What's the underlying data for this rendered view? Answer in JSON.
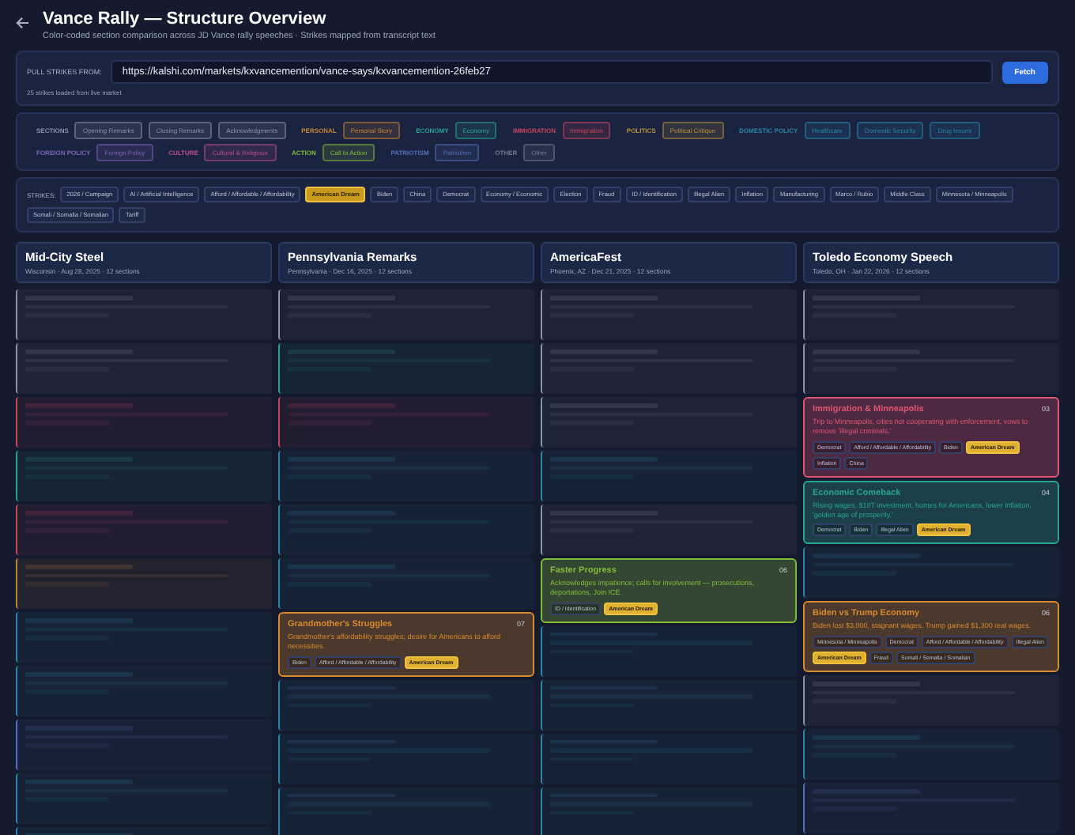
{
  "header": {
    "title": "Vance Rally — Structure Overview",
    "subtitle": "Color-coded section comparison across JD Vance rally speeches · Strikes mapped from transcript text"
  },
  "pull": {
    "label": "PULL STRIKES FROM:",
    "url": "https://kalshi.com/markets/kxvancemention/vance-says/kxvancemention-26feb27",
    "button": "Fetch",
    "status": "25 strikes loaded from live market"
  },
  "legend": [
    {
      "group": "SECTIONS",
      "color": "#8a93a8",
      "items": [
        "Opening Remarks",
        "Closing Remarks",
        "Acknowledgments"
      ]
    },
    {
      "group": "PERSONAL",
      "color": "#c8843a",
      "items": [
        "Personal Story"
      ]
    },
    {
      "group": "ECONOMY",
      "color": "#2aa392",
      "items": [
        "Economy"
      ]
    },
    {
      "group": "IMMIGRATION",
      "color": "#c8445e",
      "items": [
        "Immigration"
      ]
    },
    {
      "group": "POLITICS",
      "color": "#b8923a",
      "items": [
        "Political Critique"
      ]
    },
    {
      "group": "DOMESTIC POLICY",
      "color": "#2a86a6",
      "items": [
        "Healthcare",
        "Domestic Security",
        "Drug Issues"
      ]
    },
    {
      "group": "FOREIGN POLICY",
      "color": "#8062b8",
      "items": [
        "Foreign Policy"
      ]
    },
    {
      "group": "CULTURE",
      "color": "#b84e92",
      "items": [
        "Cultural & Religious"
      ]
    },
    {
      "group": "ACTION",
      "color": "#80bc3c",
      "items": [
        "Call to Action"
      ]
    },
    {
      "group": "PATRIOTISM",
      "color": "#5070b8",
      "items": [
        "Patriotism"
      ]
    },
    {
      "group": "OTHER",
      "color": "#767c8c",
      "items": [
        "Other"
      ]
    }
  ],
  "strikes": {
    "label": "STRIKES:",
    "items": [
      {
        "label": "2026 / Campaign",
        "selected": false
      },
      {
        "label": "AI / Artificial Intelligence",
        "selected": false
      },
      {
        "label": "Afford / Affordable / Affordability",
        "selected": false
      },
      {
        "label": "American Dream",
        "selected": true
      },
      {
        "label": "Biden",
        "selected": false
      },
      {
        "label": "China",
        "selected": false
      },
      {
        "label": "Democrat",
        "selected": false
      },
      {
        "label": "Economy / Economic",
        "selected": false
      },
      {
        "label": "Election",
        "selected": false
      },
      {
        "label": "Fraud",
        "selected": false
      },
      {
        "label": "ID / Identification",
        "selected": false
      },
      {
        "label": "Illegal Alien",
        "selected": false
      },
      {
        "label": "Inflation",
        "selected": false
      },
      {
        "label": "Manufacturing",
        "selected": false
      },
      {
        "label": "Marco / Rubio",
        "selected": false
      },
      {
        "label": "Middle Class",
        "selected": false
      },
      {
        "label": "Minnesota / Minneapolis",
        "selected": false
      },
      {
        "label": "Somali / Somalia / Somalian",
        "selected": false
      },
      {
        "label": "Tariff",
        "selected": false
      }
    ]
  },
  "speeches": [
    {
      "name": "Mid-City Steel",
      "meta": "Wisconsin · Aug 28, 2025 · 12 sections",
      "sections": [
        {
          "highlighted": false,
          "color": "#8a93a8"
        },
        {
          "highlighted": false,
          "color": "#8a93a8"
        },
        {
          "highlighted": false,
          "color": "#c8445e"
        },
        {
          "highlighted": false,
          "color": "#2aa392"
        },
        {
          "highlighted": false,
          "color": "#c8445e"
        },
        {
          "highlighted": false,
          "color": "#c8843a"
        },
        {
          "highlighted": false,
          "color": "#2a86a6"
        },
        {
          "highlighted": false,
          "color": "#2a86a6"
        },
        {
          "highlighted": false,
          "color": "#5070b8"
        },
        {
          "highlighted": false,
          "color": "#2a86a6"
        },
        {
          "highlighted": false,
          "color": "#2a86a6"
        }
      ]
    },
    {
      "name": "Pennsylvania Remarks",
      "meta": "Pennsylvania · Dec 16, 2025 · 12 sections",
      "sections": [
        {
          "highlighted": false,
          "color": "#8a93a8"
        },
        {
          "highlighted": false,
          "color": "#2aa392"
        },
        {
          "highlighted": false,
          "color": "#c8445e"
        },
        {
          "highlighted": false,
          "color": "#2a86a6"
        },
        {
          "highlighted": false,
          "color": "#2a86a6"
        },
        {
          "highlighted": false,
          "color": "#2a86a6"
        },
        {
          "highlighted": true,
          "color": "#d88a2c",
          "title": "Grandmother's Struggles",
          "number": "07",
          "description": "Grandmother's affordability struggles; desire for Americans to afford necessities.",
          "tags": [
            {
              "label": "Biden",
              "selected": false
            },
            {
              "label": "Afford / Affordable / Affordability",
              "selected": false
            },
            {
              "label": "American Dream",
              "selected": true
            }
          ]
        },
        {
          "highlighted": false,
          "color": "#2a86a6"
        },
        {
          "highlighted": false,
          "color": "#2a86a6"
        },
        {
          "highlighted": false,
          "color": "#2a86a6"
        }
      ]
    },
    {
      "name": "AmericaFest",
      "meta": "Phoenix, AZ · Dec 21, 2025 · 12 sections",
      "sections": [
        {
          "highlighted": false,
          "color": "#8a93a8"
        },
        {
          "highlighted": false,
          "color": "#8a93a8"
        },
        {
          "highlighted": false,
          "color": "#8a93a8"
        },
        {
          "highlighted": false,
          "color": "#2a86a6"
        },
        {
          "highlighted": false,
          "color": "#8a93a8"
        },
        {
          "highlighted": true,
          "color": "#80bc3c",
          "title": "Faster Progress",
          "number": "06",
          "description": "Acknowledges impatience; calls for involvement — prosecutions, deportations, Join ICE.",
          "tags": [
            {
              "label": "ID / Identification",
              "selected": false
            },
            {
              "label": "American Dream",
              "selected": true
            }
          ]
        },
        {
          "highlighted": false,
          "color": "#2a86a6"
        },
        {
          "highlighted": false,
          "color": "#2a86a6"
        },
        {
          "highlighted": false,
          "color": "#2a86a6"
        },
        {
          "highlighted": false,
          "color": "#2a86a6"
        }
      ]
    },
    {
      "name": "Toledo Economy Speech",
      "meta": "Toledo, OH · Jan 22, 2026 · 12 sections",
      "sections": [
        {
          "highlighted": false,
          "color": "#8a93a8"
        },
        {
          "highlighted": false,
          "color": "#8a93a8"
        },
        {
          "highlighted": true,
          "color": "#e05474",
          "title": "Immigration & Minneapolis",
          "number": "03",
          "description": "Trip to Minneapolis, cities not cooperating with enforcement, vows to remove 'illegal criminals.'",
          "tags": [
            {
              "label": "Democrat",
              "selected": false
            },
            {
              "label": "Afford / Affordable / Affordability",
              "selected": false
            },
            {
              "label": "Biden",
              "selected": false
            },
            {
              "label": "American Dream",
              "selected": true
            },
            {
              "label": "Inflation",
              "selected": false
            },
            {
              "label": "China",
              "selected": false
            }
          ]
        },
        {
          "highlighted": true,
          "color": "#2aa392",
          "title": "Economic Comeback",
          "number": "04",
          "description": "Rising wages, $18T investment, homes for Americans, lower inflation, 'golden age of prosperity.'",
          "tags": [
            {
              "label": "Democrat",
              "selected": false
            },
            {
              "label": "Biden",
              "selected": false
            },
            {
              "label": "Illegal Alien",
              "selected": false
            },
            {
              "label": "American Dream",
              "selected": true
            }
          ]
        },
        {
          "highlighted": false,
          "color": "#2a86a6"
        },
        {
          "highlighted": true,
          "color": "#d88a2c",
          "title": "Biden vs Trump Economy",
          "number": "06",
          "description": "Biden lost $3,000, stagnant wages. Trump gained $1,300 real wages.",
          "tags": [
            {
              "label": "Minnesota / Minneapolis",
              "selected": false
            },
            {
              "label": "Democrat",
              "selected": false
            },
            {
              "label": "Afford / Affordable / Affordability",
              "selected": false
            },
            {
              "label": "Illegal Alien",
              "selected": false
            },
            {
              "label": "American Dream",
              "selected": true
            },
            {
              "label": "Fraud",
              "selected": false
            },
            {
              "label": "Somali / Somalia / Somalian",
              "selected": false
            }
          ]
        },
        {
          "highlighted": false,
          "color": "#8a93a8"
        },
        {
          "highlighted": false,
          "color": "#2a86a6"
        },
        {
          "highlighted": false,
          "color": "#5070b8"
        }
      ]
    }
  ]
}
